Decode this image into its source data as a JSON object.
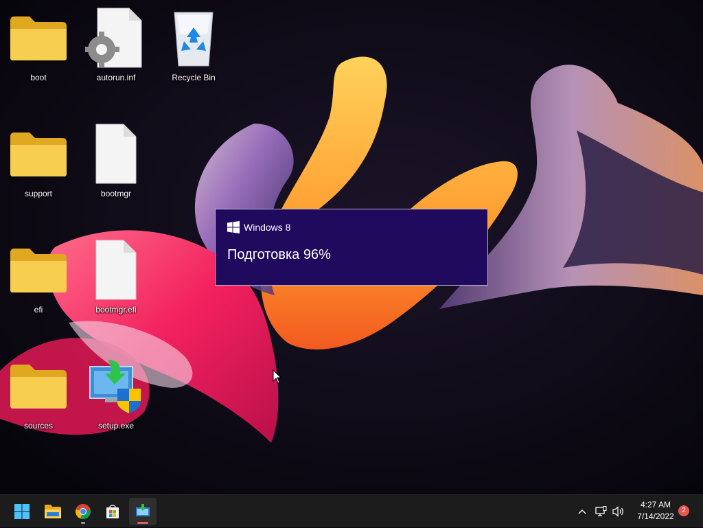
{
  "desktop": {
    "icons": [
      {
        "label": "boot",
        "icon": "folder-icon"
      },
      {
        "label": "autorun.inf",
        "icon": "settings-file-icon"
      },
      {
        "label": "Recycle Bin",
        "icon": "recycle-bin-icon"
      },
      {
        "label": "support",
        "icon": "folder-icon"
      },
      {
        "label": "bootmgr",
        "icon": "file-icon"
      },
      {
        "label": "efi",
        "icon": "folder-icon"
      },
      {
        "label": "bootmgr.efi",
        "icon": "file-icon"
      },
      {
        "label": "sources",
        "icon": "folder-icon"
      },
      {
        "label": "setup.exe",
        "icon": "setup-icon"
      }
    ]
  },
  "setup_dialog": {
    "brand": "Windows 8",
    "status": "Подготовка 96%",
    "progress_percent": 96,
    "background": "#1f0a5e"
  },
  "taskbar": {
    "apps": [
      {
        "name": "start-button",
        "icon": "windows-logo-icon"
      },
      {
        "name": "file-explorer",
        "icon": "folder-icon"
      },
      {
        "name": "chrome",
        "icon": "chrome-icon"
      },
      {
        "name": "store",
        "icon": "store-icon"
      },
      {
        "name": "setup",
        "icon": "setup-icon",
        "active": true
      }
    ],
    "tray": {
      "overflow_icon": "chevron-up-icon",
      "network_icon": "network-icon",
      "volume_icon": "volume-icon",
      "time": "4:27 AM",
      "date": "7/14/2022",
      "notification_count": "2"
    }
  },
  "colors": {
    "accent": "#e06060",
    "folder": "#f5c542",
    "taskbar": "#1c1c1c"
  }
}
